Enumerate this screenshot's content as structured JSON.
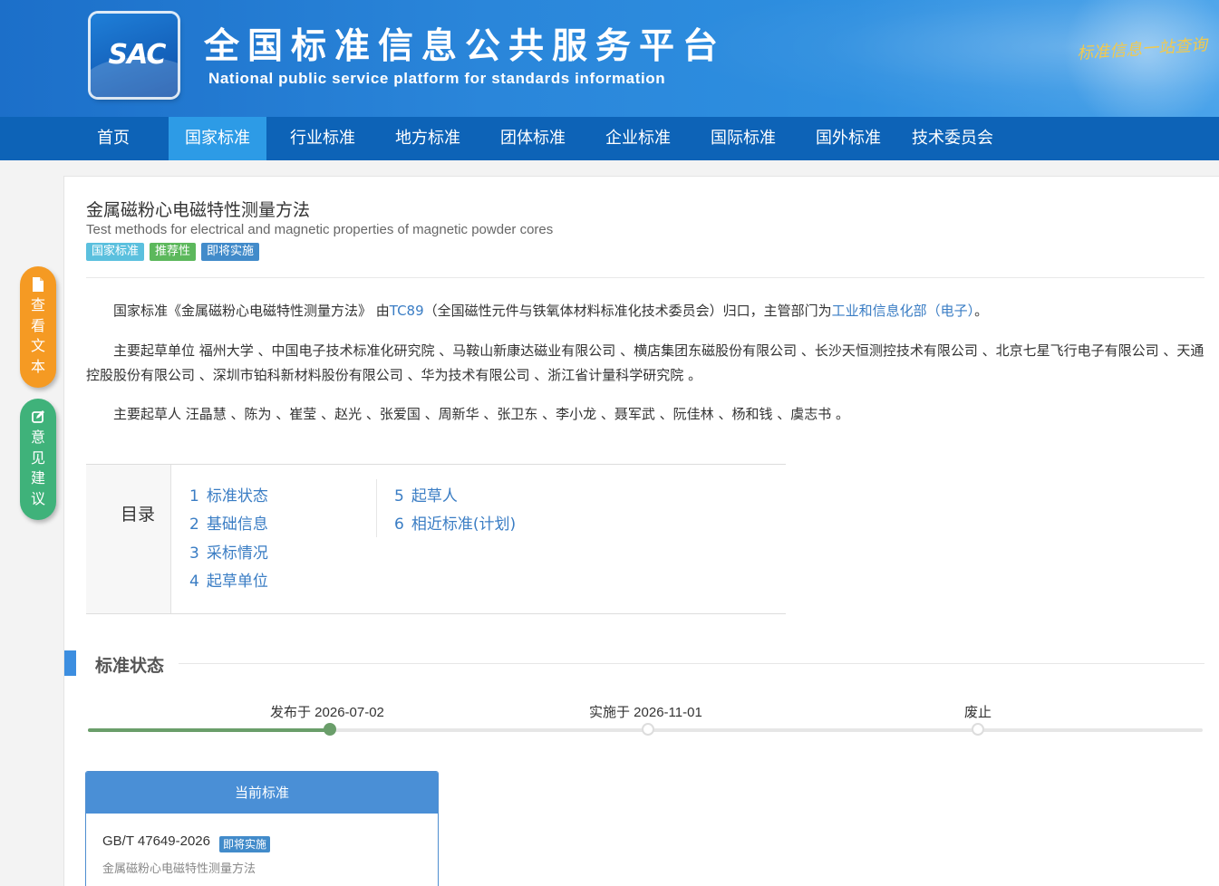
{
  "header": {
    "logo_text": "SAC",
    "title": "全国标准信息公共服务平台",
    "subtitle": "National public service platform  for standards information",
    "slogan": "标准信息一站查询"
  },
  "nav": {
    "items": [
      {
        "label": "首页",
        "active": false
      },
      {
        "label": "国家标准",
        "active": true
      },
      {
        "label": "行业标准",
        "active": false
      },
      {
        "label": "地方标准",
        "active": false
      },
      {
        "label": "团体标准",
        "active": false
      },
      {
        "label": "企业标准",
        "active": false
      },
      {
        "label": "国际标准",
        "active": false
      },
      {
        "label": "国外标准",
        "active": false
      },
      {
        "label": "技术委员会",
        "active": false
      }
    ]
  },
  "document": {
    "title": "金属磁粉心电磁特性测量方法",
    "subtitle": "Test methods for electrical and magnetic properties of magnetic powder cores",
    "tags": [
      "国家标准",
      "推荐性",
      "即将实施"
    ]
  },
  "intro": {
    "p1_prefix": "国家标准《金属磁粉心电磁特性测量方法》 由",
    "p1_tc_link": "TC89",
    "p1_middle": "（全国磁性元件与铁氧体材料标准化技术委员会）归口，主管部门为",
    "p1_dept_link": "工业和信息化部（电子）",
    "p1_suffix": "。",
    "p2": "主要起草单位 福州大学 、中国电子技术标准化研究院 、马鞍山新康达磁业有限公司 、横店集团东磁股份有限公司 、长沙天恒测控技术有限公司 、北京七星飞行电子有限公司 、天通控股股份有限公司 、深圳市铂科新材料股份有限公司 、华为技术有限公司 、浙江省计量科学研究院 。",
    "p3": "主要起草人 汪晶慧 、陈为 、崔莹 、赵光 、张爱国 、周新华 、张卫东 、李小龙 、聂军武 、阮佳林 、杨和钱 、虞志书 。"
  },
  "toc": {
    "label": "目录",
    "items": [
      {
        "num": "1",
        "label": "标准状态"
      },
      {
        "num": "2",
        "label": "基础信息"
      },
      {
        "num": "3",
        "label": "采标情况"
      },
      {
        "num": "4",
        "label": "起草单位"
      },
      {
        "num": "5",
        "label": "起草人"
      },
      {
        "num": "6",
        "label": "相近标准(计划)"
      }
    ]
  },
  "status": {
    "heading": "标准状态",
    "timeline": [
      {
        "label": "发布于 2026-07-02",
        "reached": true
      },
      {
        "label": "实施于 2026-11-01",
        "reached": false
      },
      {
        "label": "废止",
        "reached": false
      }
    ]
  },
  "current": {
    "header": "当前标准",
    "code": "GB/T 47649-2026",
    "badge": "即将实施",
    "name": "金属磁粉心电磁特性测量方法"
  },
  "side_buttons": {
    "view_text": [
      "查",
      "看",
      "文",
      "本"
    ],
    "feedback": [
      "意",
      "见",
      "建",
      "议"
    ]
  },
  "colors": {
    "header_blue": "#2a86da",
    "nav_blue": "#0d63b7",
    "nav_active": "#2d9be6",
    "link": "#3a7dc4",
    "timeline_done": "#6a9e6a",
    "orange_button": "#f59a23",
    "green_button": "#3fb27a"
  }
}
